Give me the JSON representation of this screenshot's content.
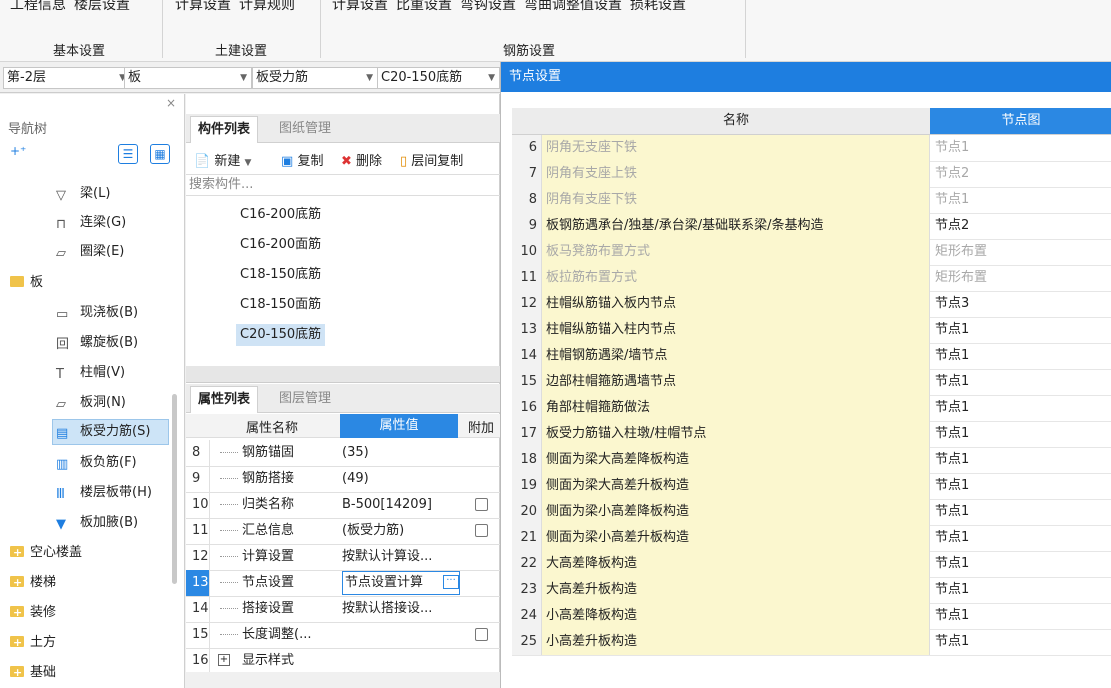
{
  "ribbon": {
    "groups": [
      {
        "label": "基本设置",
        "items": [
          "工程信息",
          "楼层设置"
        ]
      },
      {
        "label": "土建设置",
        "items": [
          "计算设置",
          "计算规则"
        ]
      },
      {
        "label": "钢筋设置",
        "items": [
          "计算设置",
          "比重设置",
          "弯钩设置",
          "弯曲调整值设置",
          "损耗设置"
        ]
      }
    ]
  },
  "filters": {
    "floor": "第-2层",
    "type": "板",
    "subtype": "板受力筋",
    "component": "C20-150底筋"
  },
  "nav": {
    "title": "导航树",
    "close": "×",
    "items": [
      {
        "label": "梁(L)"
      },
      {
        "label": "连梁(G)"
      },
      {
        "label": "圈梁(E)"
      },
      {
        "label": "板"
      },
      {
        "label": "现浇板(B)"
      },
      {
        "label": "螺旋板(B)"
      },
      {
        "label": "柱帽(V)"
      },
      {
        "label": "板洞(N)"
      },
      {
        "label": "板受力筋(S)"
      },
      {
        "label": "板负筋(F)"
      },
      {
        "label": "楼层板带(H)"
      },
      {
        "label": "板加腋(B)"
      },
      {
        "label": "空心楼盖"
      },
      {
        "label": "楼梯"
      },
      {
        "label": "装修"
      },
      {
        "label": "土方"
      },
      {
        "label": "基础"
      }
    ]
  },
  "comp": {
    "tab_active": "构件列表",
    "tab_other": "图纸管理",
    "toolbar": {
      "new": "新建",
      "copy": "复制",
      "delete": "删除",
      "floor_copy": "层间复制"
    },
    "search_placeholder": "搜索构件...",
    "items": [
      "C16-200底筋",
      "C16-200面筋",
      "C18-150底筋",
      "C18-150面筋",
      "C20-150底筋"
    ]
  },
  "prop": {
    "tab_active": "属性列表",
    "tab_other": "图层管理",
    "headers": {
      "name": "属性名称",
      "value": "属性值",
      "extra": "附加"
    },
    "rows": [
      {
        "n": "8",
        "name": "钢筋锚固",
        "value": "(35)"
      },
      {
        "n": "9",
        "name": "钢筋搭接",
        "value": "(49)"
      },
      {
        "n": "10",
        "name": "归类名称",
        "value": "B-500[14209]"
      },
      {
        "n": "11",
        "name": "汇总信息",
        "value": "(板受力筋)"
      },
      {
        "n": "12",
        "name": "计算设置",
        "value": "按默认计算设..."
      },
      {
        "n": "13",
        "name": "节点设置",
        "value": "节点设置计算"
      },
      {
        "n": "14",
        "name": "搭接设置",
        "value": "按默认搭接设..."
      },
      {
        "n": "15",
        "name": "长度调整(...",
        "value": ""
      },
      {
        "n": "16",
        "name": "显示样式",
        "value": ""
      }
    ]
  },
  "dialog": {
    "title": "节点设置",
    "headers": {
      "name": "名称",
      "node": "节点图"
    },
    "rows": [
      {
        "n": "6",
        "name": "阴角无支座下铁",
        "node": "节点1"
      },
      {
        "n": "7",
        "name": "阴角有支座上铁",
        "node": "节点2"
      },
      {
        "n": "8",
        "name": "阴角有支座下铁",
        "node": "节点1"
      },
      {
        "n": "9",
        "name": "板钢筋遇承台/独基/承台梁/基础联系梁/条基构造",
        "node": "节点2"
      },
      {
        "n": "10",
        "name": "板马凳筋布置方式",
        "node": "矩形布置"
      },
      {
        "n": "11",
        "name": "板拉筋布置方式",
        "node": "矩形布置"
      },
      {
        "n": "12",
        "name": "柱帽纵筋锚入板内节点",
        "node": "节点3"
      },
      {
        "n": "13",
        "name": "柱帽纵筋锚入柱内节点",
        "node": "节点1"
      },
      {
        "n": "14",
        "name": "柱帽钢筋遇梁/墙节点",
        "node": "节点1"
      },
      {
        "n": "15",
        "name": "边部柱帽箍筋遇墙节点",
        "node": "节点1"
      },
      {
        "n": "16",
        "name": "角部柱帽箍筋做法",
        "node": "节点1"
      },
      {
        "n": "17",
        "name": "板受力筋锚入柱墩/柱帽节点",
        "node": "节点1"
      },
      {
        "n": "18",
        "name": "侧面为梁大高差降板构造",
        "node": "节点1"
      },
      {
        "n": "19",
        "name": "侧面为梁大高差升板构造",
        "node": "节点1"
      },
      {
        "n": "20",
        "name": "侧面为梁小高差降板构造",
        "node": "节点1"
      },
      {
        "n": "21",
        "name": "侧面为梁小高差升板构造",
        "node": "节点1"
      },
      {
        "n": "22",
        "name": "大高差降板构造",
        "node": "节点1"
      },
      {
        "n": "23",
        "name": "大高差升板构造",
        "node": "节点1"
      },
      {
        "n": "24",
        "name": "小高差降板构造",
        "node": "节点1"
      },
      {
        "n": "25",
        "name": "小高差升板构造",
        "node": "节点1"
      }
    ]
  }
}
